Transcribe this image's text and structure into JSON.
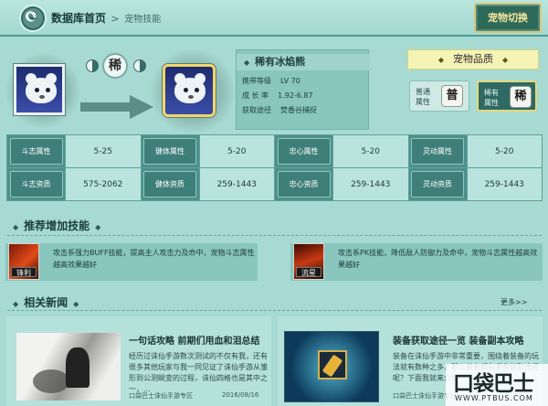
{
  "header": {
    "home": "数据库首页",
    "separator": ">",
    "current": "宠物技能",
    "switch_button": "宠物切换"
  },
  "pet": {
    "rarity_char": "稀",
    "name": "稀有冰焰熊",
    "level_label": "携带等级",
    "level_value": "LV 70",
    "growth_label": "成 长 率",
    "growth_value": "1.92-6.87",
    "obtain_label": "获取途径",
    "obtain_value": "焚香谷捕捉"
  },
  "quality": {
    "title": "宠物品质",
    "badges": [
      {
        "label": "普通属性",
        "seal": "普"
      },
      {
        "label": "稀有属性",
        "seal": "稀"
      }
    ]
  },
  "attributes": {
    "rows": [
      [
        {
          "k": "斗志属性",
          "v": "5-25"
        },
        {
          "k": "健体属性",
          "v": "5-20"
        },
        {
          "k": "忠心属性",
          "v": "5-20"
        },
        {
          "k": "灵动属性",
          "v": "5-20"
        }
      ],
      [
        {
          "k": "斗志资质",
          "v": "575-2062"
        },
        {
          "k": "健体资质",
          "v": "259-1443"
        },
        {
          "k": "忠心资质",
          "v": "259-1443"
        },
        {
          "k": "灵动资质",
          "v": "259-1443"
        }
      ]
    ]
  },
  "skills_section": {
    "title": "推荐增加技能",
    "items": [
      {
        "tag": "锋利",
        "desc": "攻击系强力BUFF技能，提高主人攻击力及命中，宠物斗志属性越高效果越好"
      },
      {
        "tag": "流星",
        "desc": "攻击系PK技能，降低敌人防御力及命中，宠物斗志属性越高效果越好"
      }
    ]
  },
  "news_section": {
    "title": "相关新闻",
    "more": "更多>>",
    "items": [
      {
        "title": "一句话攻略 前期们用血和泪总结",
        "body": "经历过诛仙手游数次测试的不仅有我，还有很多其他玩家与我一同见证了诛仙手游从雏形到公测蜕变的过程，诛仙四格也是其中之一，...",
        "source": "口袋巴士诛仙手游专区",
        "date": "2016/08/16"
      },
      {
        "title": "装备获取途径一览 装备副本攻略",
        "body": "装备在诛仙手游中非常重要，围绕着装备的玩法就有数种之多，那么装备都有哪些获取途径呢？下面我就来介绍一下...",
        "source": "口袋巴士诛仙手游专区",
        "date": ""
      }
    ]
  },
  "watermark": {
    "text": "口袋巴士",
    "url": "WWW.PTBUS.COM"
  }
}
